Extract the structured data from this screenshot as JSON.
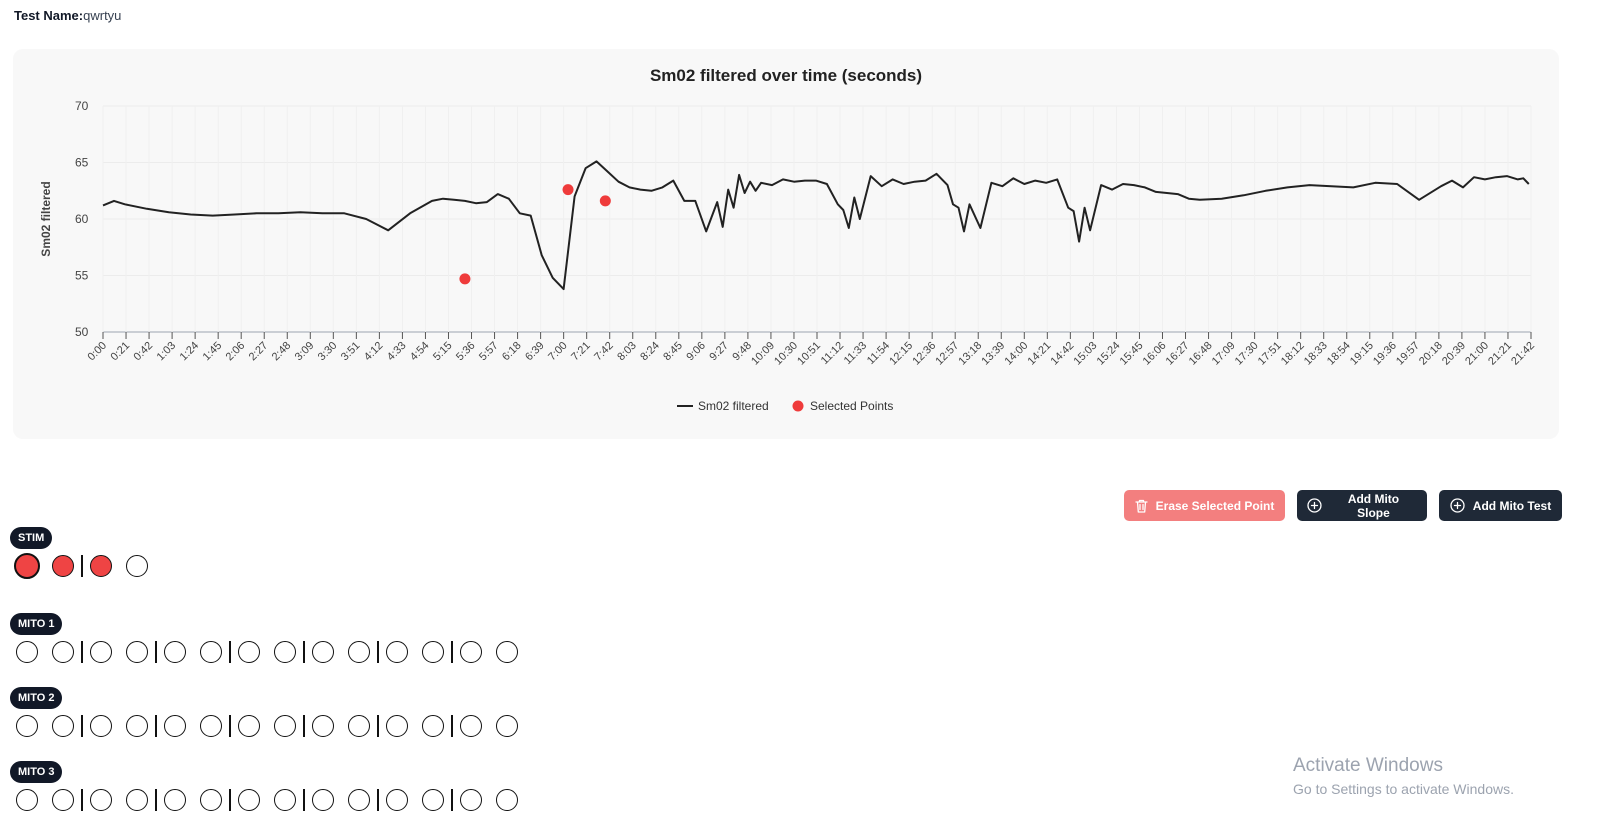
{
  "header": {
    "test_name_label": "Test Name:",
    "test_name_value": "qwrtyu"
  },
  "chart_data": {
    "type": "line",
    "title": "Sm02 filtered over time (seconds)",
    "xlabel": "",
    "ylabel": "Sm02 filtered",
    "ylim": [
      50,
      70
    ],
    "yticks": [
      50,
      55,
      60,
      65,
      70
    ],
    "xlim": [
      0,
      1302
    ],
    "xtick_labels": [
      "0:00",
      "0:21",
      "0:42",
      "1:03",
      "1:24",
      "1:45",
      "2:06",
      "2:27",
      "2:48",
      "3:09",
      "3:30",
      "3:51",
      "4:12",
      "4:33",
      "4:54",
      "5:15",
      "5:36",
      "5:57",
      "6:18",
      "6:39",
      "7:00",
      "7:21",
      "7:42",
      "8:03",
      "8:24",
      "8:45",
      "9:06",
      "9:27",
      "9:48",
      "10:09",
      "10:30",
      "10:51",
      "11:12",
      "11:33",
      "11:54",
      "12:15",
      "12:36",
      "12:57",
      "13:18",
      "13:39",
      "14:00",
      "14:21",
      "14:42",
      "15:03",
      "15:24",
      "15:45",
      "16:06",
      "16:27",
      "16:48",
      "17:09",
      "17:30",
      "17:51",
      "18:12",
      "18:33",
      "18:54",
      "19:15",
      "19:36",
      "19:57",
      "20:18",
      "20:39",
      "21:00",
      "21:21",
      "21:42"
    ],
    "grid": true,
    "legend_position": "bottom",
    "series": [
      {
        "name": "Sm02 filtered",
        "color": "#222222",
        "x": [
          0,
          10,
          20,
          40,
          60,
          80,
          100,
          120,
          140,
          160,
          180,
          200,
          220,
          240,
          260,
          280,
          300,
          310,
          320,
          330,
          340,
          350,
          360,
          370,
          380,
          390,
          400,
          410,
          420,
          430,
          440,
          450,
          460,
          470,
          480,
          490,
          500,
          510,
          520,
          530,
          540,
          550,
          560,
          565,
          570,
          575,
          580,
          585,
          590,
          595,
          600,
          610,
          620,
          630,
          640,
          650,
          660,
          670,
          675,
          680,
          685,
          690,
          700,
          710,
          720,
          730,
          740,
          750,
          760,
          770,
          775,
          780,
          785,
          790,
          800,
          810,
          820,
          830,
          840,
          850,
          860,
          870,
          880,
          885,
          890,
          895,
          900,
          910,
          920,
          930,
          940,
          950,
          960,
          970,
          980,
          990,
          1000,
          1020,
          1040,
          1060,
          1080,
          1100,
          1120,
          1140,
          1160,
          1180,
          1200,
          1220,
          1230,
          1240,
          1250,
          1260,
          1270,
          1280,
          1290,
          1295,
          1300
        ],
        "y": [
          61.2,
          61.6,
          61.3,
          60.9,
          60.6,
          60.4,
          60.3,
          60.4,
          60.5,
          60.5,
          60.6,
          60.5,
          60.5,
          60.0,
          59.0,
          60.5,
          61.6,
          61.8,
          61.7,
          61.6,
          61.4,
          61.5,
          62.2,
          61.8,
          60.5,
          60.3,
          56.8,
          54.8,
          53.8,
          62.0,
          64.5,
          65.1,
          64.2,
          63.3,
          62.8,
          62.6,
          62.5,
          62.8,
          63.4,
          61.6,
          61.6,
          58.9,
          61.5,
          59.3,
          62.6,
          61.0,
          63.9,
          62.3,
          63.3,
          62.5,
          63.2,
          63.0,
          63.5,
          63.3,
          63.4,
          63.4,
          63.1,
          61.3,
          60.8,
          59.2,
          61.9,
          60.0,
          63.8,
          62.9,
          63.5,
          63.1,
          63.3,
          63.4,
          64.0,
          63.0,
          61.3,
          61.0,
          58.9,
          61.3,
          59.2,
          63.2,
          62.9,
          63.6,
          63.1,
          63.4,
          63.2,
          63.5,
          61.0,
          60.7,
          58.0,
          61.0,
          59.0,
          63.0,
          62.6,
          63.1,
          63.0,
          62.8,
          62.4,
          62.3,
          62.2,
          61.8,
          61.7,
          61.8,
          62.1,
          62.5,
          62.8,
          63.0,
          62.9,
          62.8,
          63.2,
          63.1,
          61.7,
          62.9,
          63.4,
          62.8,
          63.7,
          63.5,
          63.7,
          63.8,
          63.5,
          63.6,
          63.1
        ]
      },
      {
        "name": "Selected Points",
        "color": "#ef3b3b",
        "x": [
          330,
          424,
          458
        ],
        "y": [
          54.7,
          62.6,
          61.6
        ]
      }
    ]
  },
  "actions": {
    "erase_label": "Erase Selected Point",
    "add_slope_label": "Add Mito Slope",
    "add_test_label": "Add Mito Test"
  },
  "groups": [
    {
      "label": "STIM",
      "circles": [
        "selected",
        "filled",
        "sep",
        "filled",
        "empty"
      ]
    },
    {
      "label": "MITO 1",
      "circles": [
        "empty",
        "empty",
        "sep",
        "empty",
        "empty",
        "sep",
        "empty",
        "empty",
        "sep",
        "empty",
        "empty",
        "sep",
        "empty",
        "empty",
        "sep",
        "empty",
        "empty",
        "sep",
        "empty",
        "empty"
      ]
    },
    {
      "label": "MITO 2",
      "circles": [
        "empty",
        "empty",
        "sep",
        "empty",
        "empty",
        "sep",
        "empty",
        "empty",
        "sep",
        "empty",
        "empty",
        "sep",
        "empty",
        "empty",
        "sep",
        "empty",
        "empty",
        "sep",
        "empty",
        "empty"
      ]
    },
    {
      "label": "MITO 3",
      "circles": [
        "empty",
        "empty",
        "sep",
        "empty",
        "empty",
        "sep",
        "empty",
        "empty",
        "sep",
        "empty",
        "empty",
        "sep",
        "empty",
        "empty",
        "sep",
        "empty",
        "empty",
        "sep",
        "empty",
        "empty"
      ]
    }
  ],
  "watermark": {
    "line1": "Activate Windows",
    "line2": "Go to Settings to activate Windows."
  }
}
